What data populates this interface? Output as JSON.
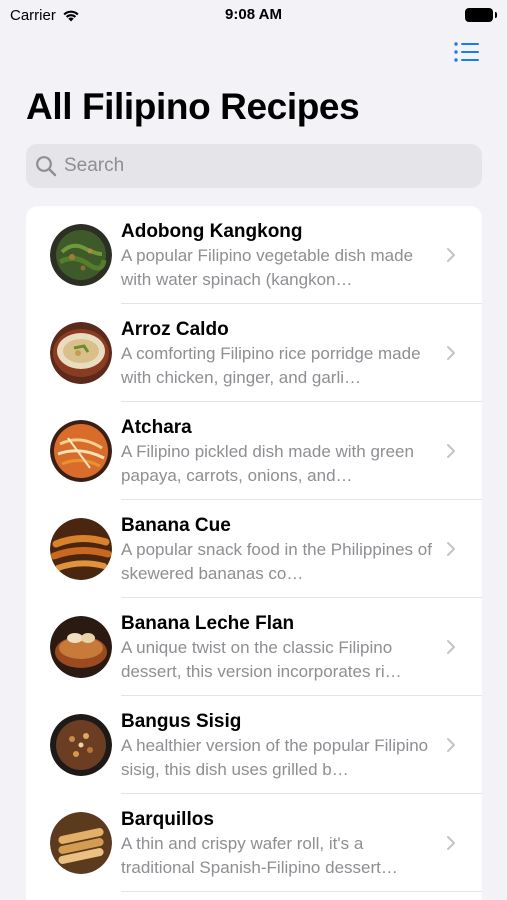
{
  "status_bar": {
    "carrier": "Carrier",
    "time": "9:08 AM"
  },
  "nav": {
    "menu_icon": "list-icon",
    "accent_color": "#1a7cf5"
  },
  "page": {
    "title": "All Filipino Recipes"
  },
  "search": {
    "placeholder": "Search",
    "value": ""
  },
  "recipes": [
    {
      "name": "Adobong Kangkong",
      "description": "A popular Filipino vegetable dish made with water spinach (kangkon…"
    },
    {
      "name": "Arroz Caldo",
      "description": "A comforting Filipino rice porridge made with chicken, ginger, and garli…"
    },
    {
      "name": "Atchara",
      "description": "A Filipino pickled dish made with green papaya, carrots, onions, and…"
    },
    {
      "name": "Banana Cue",
      "description": "A popular snack food in the Philippines of skewered bananas co…"
    },
    {
      "name": "Banana Leche Flan",
      "description": "A unique twist on the classic Filipino dessert, this version incorporates ri…"
    },
    {
      "name": "Bangus Sisig",
      "description": "A healthier version of the popular Filipino sisig, this dish uses grilled b…"
    },
    {
      "name": "Barquillos",
      "description": "A thin and crispy wafer roll, it's a traditional Spanish-Filipino dessert…"
    }
  ]
}
